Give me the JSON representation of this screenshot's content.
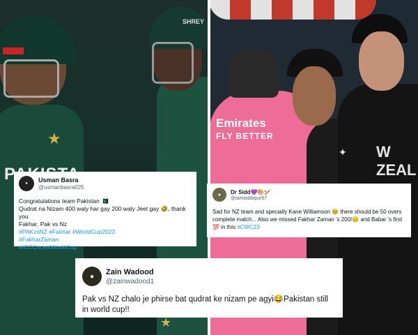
{
  "photo": {
    "left_jersey_text": "PAKISTA",
    "left_helmet_brand": "SHREY",
    "umpire_sponsor_line1": "Emirates",
    "umpire_sponsor_line2": "FLY BETTER",
    "right_jersey_text": "W ZEAL"
  },
  "tweets": [
    {
      "name": "Usman Basra",
      "handle": "@usmanbasra025",
      "avatar_icon": "avatar-icon",
      "lines": [
        "Congratulations team Pakistan 🇵🇰",
        "Qudrat na Nizam 400 waly har gay 200 waly Jeet gay 🤣, thank you",
        "Fakhar, Pak vs Nz"
      ],
      "hashtags_line1": "#PAKvsNZ #Fakhar #WorldCup2023",
      "hashtags_line2": "#FakharZaman",
      "hashtags_line3": "#ICCCricketWorldCup"
    },
    {
      "name": "Dr Sidd💜🎨🏏",
      "handle": "@iamsiddique57",
      "avatar_icon": "avatar-icon",
      "text_part1": "Sad for NZ team and specially Kane Williamson 🥹 there should be 50 overs complete match... Also we missed Fakhar Zaman 's 200/😔 and Babar 's first 💯 in this ",
      "hashtag": "#CWC23"
    },
    {
      "name": "Zain Wadood",
      "handle": "@zainwadood1",
      "avatar_icon": "avatar-icon",
      "text": "Pak vs NZ chalo je phirse bat qudrat ke nizam pe agyi😂Pakistan still in world cup!!"
    }
  ]
}
